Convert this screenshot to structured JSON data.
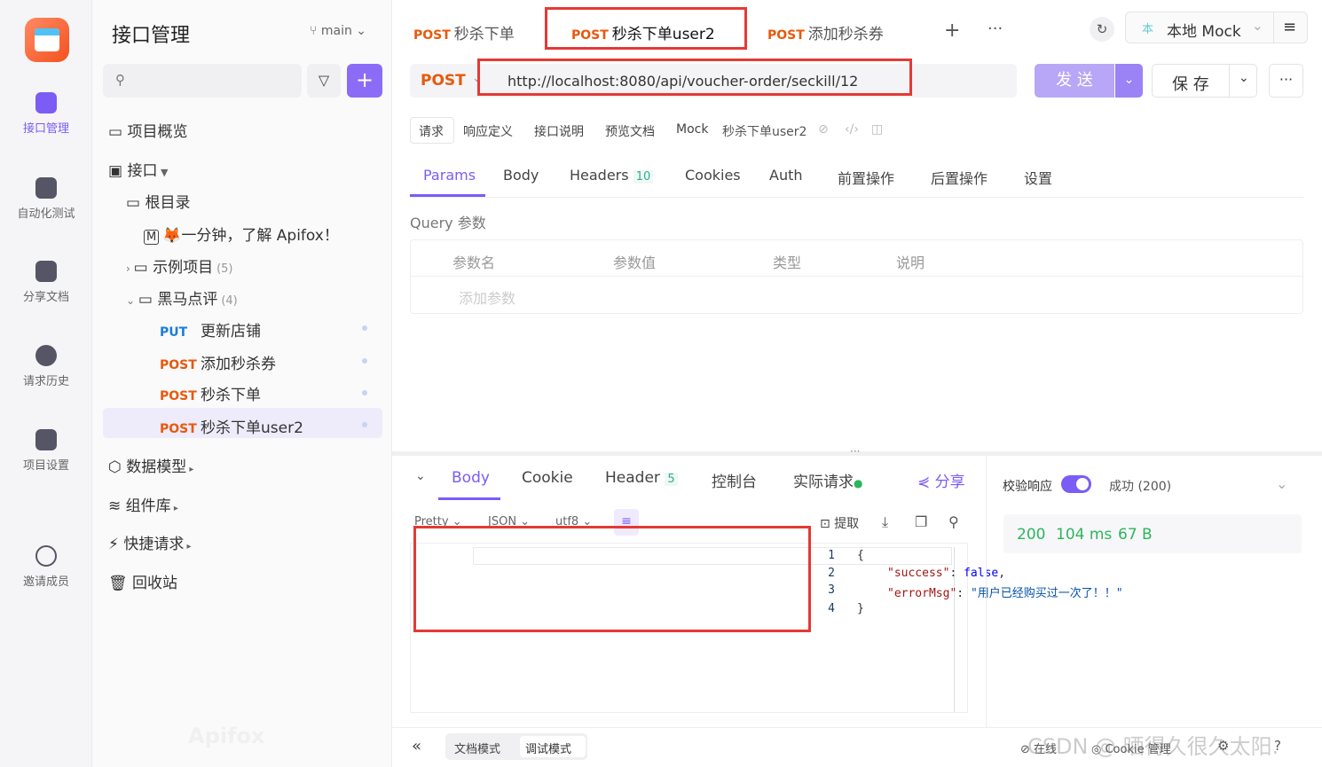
{
  "rail": {
    "items": [
      {
        "label": "接口管理"
      },
      {
        "label": "自动化测试"
      },
      {
        "label": "分享文档"
      },
      {
        "label": "请求历史"
      },
      {
        "label": "项目设置"
      },
      {
        "label": "邀请成员"
      }
    ]
  },
  "sidebar": {
    "title": "接口管理",
    "branch": "main",
    "search_placeholder": "",
    "tree": {
      "overview": "项目概览",
      "api": "接口",
      "root": "根目录",
      "intro": "🦊一分钟，了解 Apifox！",
      "examples": {
        "label": "示例项目",
        "count": "(5)"
      },
      "hmdp": {
        "label": "黑马点评",
        "count": "(4)"
      },
      "endpoints": [
        {
          "method": "PUT",
          "name": "更新店铺"
        },
        {
          "method": "POST",
          "name": "添加秒杀券"
        },
        {
          "method": "POST",
          "name": "秒杀下单"
        },
        {
          "method": "POST",
          "name": "秒杀下单user2"
        }
      ],
      "models": "数据模型",
      "components": "组件库",
      "quick": "快捷请求",
      "trash": "回收站"
    },
    "watermark": "Apifox"
  },
  "tabs": [
    {
      "method": "POST",
      "name": "秒杀下单"
    },
    {
      "method": "POST",
      "name": "秒杀下单user2"
    },
    {
      "method": "POST",
      "name": "添加秒杀券"
    }
  ],
  "env": "本地 Mock",
  "env_badge": "本",
  "request": {
    "method": "POST",
    "url": "http://localhost:8080/api/voucher-order/seckill/12",
    "send": "发 送",
    "save": "保 存"
  },
  "subtabs": [
    "请求",
    "响应定义",
    "接口说明",
    "预览文档",
    "Mock"
  ],
  "subtab_name": "秒杀下单user2",
  "param_tabs": {
    "params": "Params",
    "body": "Body",
    "headers": "Headers",
    "headers_count": "10",
    "cookies": "Cookies",
    "auth": "Auth",
    "pre": "前置操作",
    "post": "后置操作",
    "settings": "设置"
  },
  "query": {
    "title": "Query 参数",
    "cols": [
      "参数名",
      "参数值",
      "类型",
      "说明"
    ],
    "add_placeholder": "添加参数"
  },
  "response": {
    "tabs": {
      "body": "Body",
      "cookie": "Cookie",
      "header": "Header",
      "header_count": "5",
      "console": "控制台",
      "actual": "实际请求"
    },
    "share": "分享",
    "format": {
      "pretty": "Pretty",
      "json": "JSON",
      "enc": "utf8"
    },
    "extract": "提取",
    "lines": [
      "1",
      "2",
      "3",
      "4"
    ],
    "code": {
      "open": "{",
      "k1": "\"success\"",
      "v1": "false",
      "k2": "\"errorMsg\"",
      "v2": "\"用户已经购买过一次了！！\"",
      "close": "}"
    },
    "validate": "校验响应",
    "status_label": "成功 (200)",
    "stats": {
      "code": "200",
      "time": "104 ms",
      "size": "67 B"
    }
  },
  "footer": {
    "doc_mode": "文档模式",
    "debug_mode": "调试模式",
    "online": "在线",
    "cookie": "Cookie 管理",
    "watermark": "CSDN @ 晒得久很久太阳."
  },
  "colors": {
    "accent": "#7b5cf5",
    "post": "#e8590c",
    "put": "#1c7ed6",
    "highlight": "#e53935"
  }
}
